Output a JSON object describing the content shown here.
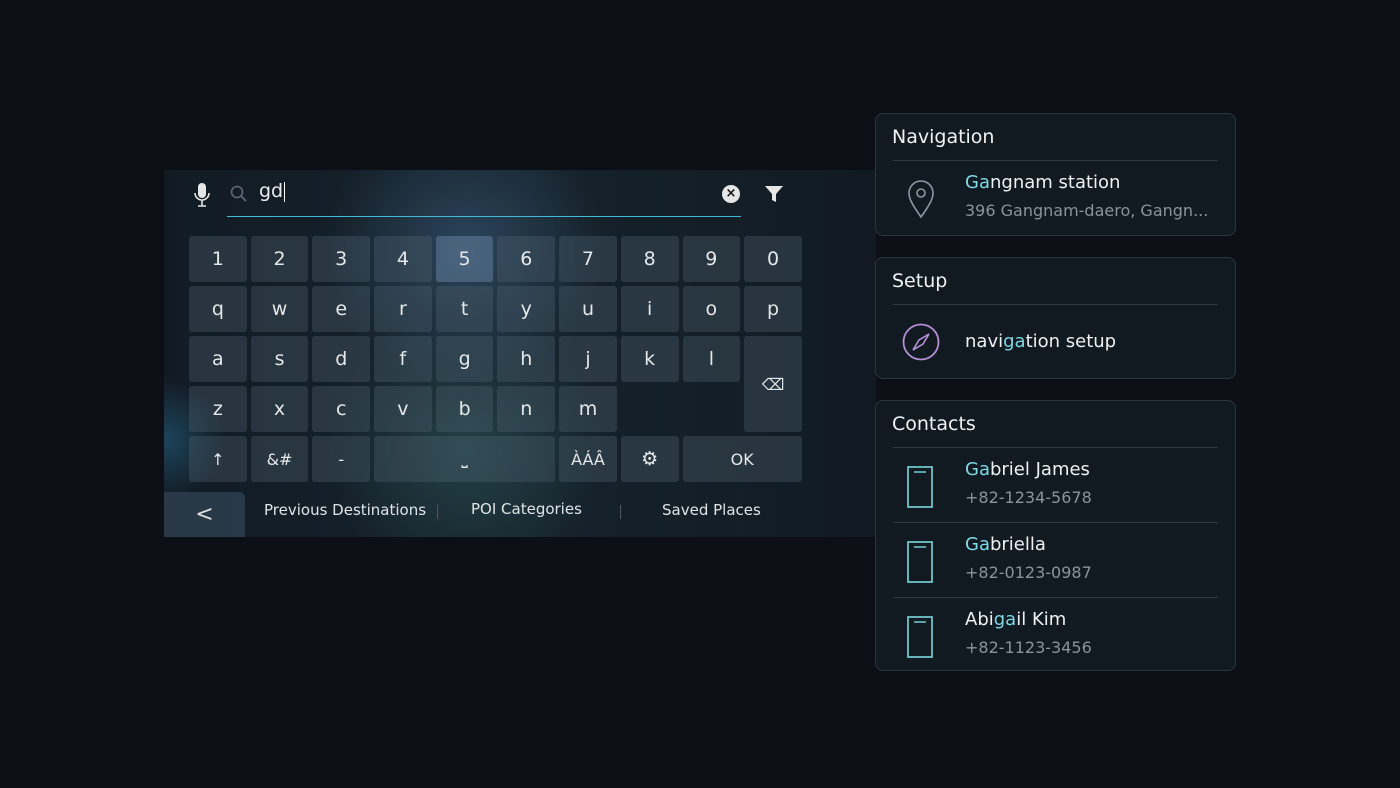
{
  "search": {
    "query": "gd"
  },
  "keys": {
    "row1": [
      "1",
      "2",
      "3",
      "4",
      "5",
      "6",
      "7",
      "8",
      "9",
      "0"
    ],
    "row2": [
      "q",
      "w",
      "e",
      "r",
      "t",
      "y",
      "u",
      "i",
      "o",
      "p"
    ],
    "row3": [
      "a",
      "s",
      "d",
      "f",
      "g",
      "h",
      "j",
      "k",
      "l"
    ],
    "row4": [
      "z",
      "x",
      "c",
      "v",
      "b",
      "n",
      "m"
    ],
    "symbols": "&#",
    "dash": "-",
    "accents": "ÀÁÂ",
    "ok": "OK",
    "shift": "↑",
    "space": "⎵",
    "backspace": "⌫"
  },
  "tabs": {
    "back": "<",
    "items": [
      "Previous Destinations",
      "POI Categories",
      "Saved Places"
    ]
  },
  "highlight_color": "#7fd8e6",
  "navigation": {
    "title": "Navigation",
    "item": {
      "pre": "",
      "hl": "Ga",
      "post": "ngnam station",
      "address": "396 Gangnam-daero, Gangn..."
    }
  },
  "setup": {
    "title": "Setup",
    "item": {
      "pre": "navi",
      "hl": "ga",
      "post": "tion setup"
    }
  },
  "contacts": {
    "title": "Contacts",
    "items": [
      {
        "pre": "",
        "hl": "Ga",
        "post": "briel James",
        "phone": "+82-1234-5678"
      },
      {
        "pre": "",
        "hl": "Ga",
        "post": "briella",
        "phone": "+82-0123-0987"
      },
      {
        "pre": "Abi",
        "hl": "ga",
        "post": "il Kim",
        "phone": "+82-1123-3456"
      }
    ]
  }
}
